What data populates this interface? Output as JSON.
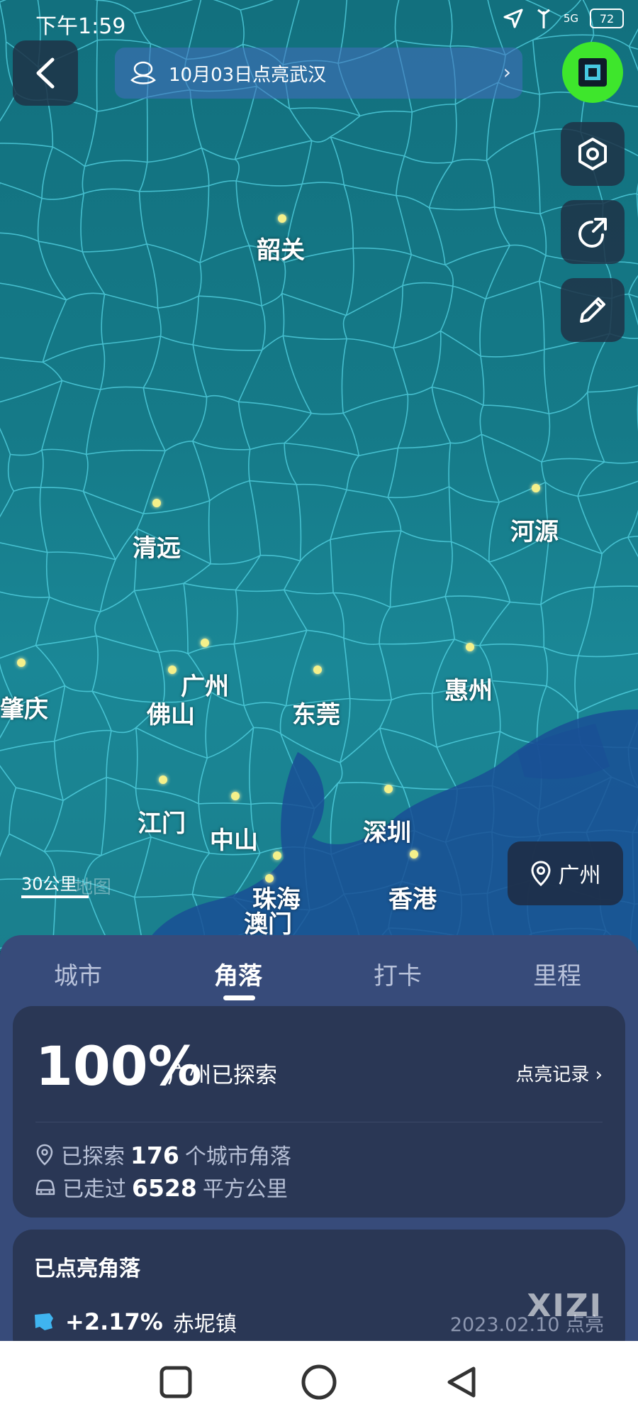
{
  "status": {
    "time": "下午1:59",
    "network": "5G",
    "battery": "72"
  },
  "top_banner": {
    "text": "10月03日点亮武汉"
  },
  "map": {
    "cities": [
      {
        "name": "韶关"
      },
      {
        "name": "清远"
      },
      {
        "name": "河源"
      },
      {
        "name": "肇庆"
      },
      {
        "name": "广州"
      },
      {
        "name": "佛山"
      },
      {
        "name": "东莞"
      },
      {
        "name": "惠州"
      },
      {
        "name": "江门"
      },
      {
        "name": "中山"
      },
      {
        "name": "深圳"
      },
      {
        "name": "珠海"
      },
      {
        "name": "香港"
      },
      {
        "name": "澳门"
      }
    ],
    "scale_label": "30公里",
    "location_button": "广州"
  },
  "tabs": [
    "城市",
    "角落",
    "打卡",
    "里程"
  ],
  "active_tab": "角落",
  "summary": {
    "percent": "100%",
    "explored_label": "广州已探索",
    "record_link": "点亮记录 ›",
    "stats": [
      {
        "prefix": "已探索",
        "value": "176",
        "suffix": "个城市角落"
      },
      {
        "prefix": "已走过",
        "value": "6528",
        "suffix": "平方公里"
      }
    ]
  },
  "lit_corners": {
    "title": "已点亮角落",
    "items": [
      {
        "percent": "+2.17%",
        "name": "赤坭镇",
        "date": "2023.02.10 点亮"
      }
    ]
  },
  "watermark": "XIZI"
}
